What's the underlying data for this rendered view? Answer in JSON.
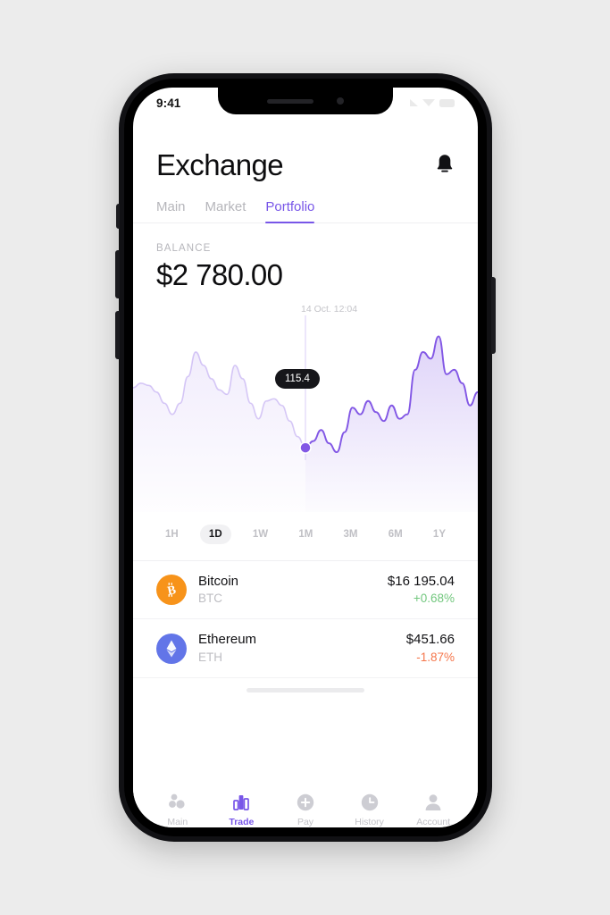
{
  "status_bar": {
    "time": "9:41",
    "icons": [
      "signal-icon",
      "wifi-icon",
      "battery-icon"
    ]
  },
  "header": {
    "title": "Exchange",
    "notification_icon": "bell-icon"
  },
  "tabs": [
    {
      "label": "Main",
      "active": false
    },
    {
      "label": "Market",
      "active": false
    },
    {
      "label": "Portfolio",
      "active": true
    }
  ],
  "balance": {
    "label": "BALANCE",
    "amount": "$2 780.00"
  },
  "chart_data": {
    "type": "area",
    "title": "",
    "xlabel": "",
    "ylabel": "",
    "tooltip_value": "115.4",
    "tooltip_date": "14 Oct. 12:04",
    "marker_index": 22,
    "line_color": "#8257e5",
    "fill_color": "#8257e5",
    "faded_before_marker": true,
    "grid": false,
    "legend": null,
    "ylim": [
      85,
      150
    ],
    "x": [
      0,
      1,
      2,
      3,
      4,
      5,
      6,
      7,
      8,
      9,
      10,
      11,
      12,
      13,
      14,
      15,
      16,
      17,
      18,
      19,
      20,
      21,
      22,
      23,
      24,
      25,
      26,
      27,
      28,
      29,
      30,
      31,
      32,
      33,
      34,
      35,
      36,
      37,
      38,
      39,
      40,
      41,
      42,
      43,
      44
    ],
    "values": [
      124,
      126,
      125,
      122,
      117,
      112,
      117,
      129,
      140,
      134,
      128,
      123,
      121,
      134,
      128,
      117,
      110,
      118,
      119,
      116,
      109,
      102,
      97,
      100,
      105,
      99,
      95,
      104,
      115,
      112,
      118,
      113,
      109,
      116,
      110,
      112,
      132,
      140,
      137,
      147,
      130,
      132,
      126,
      116,
      122
    ]
  },
  "ranges": [
    {
      "label": "1H",
      "active": false
    },
    {
      "label": "1D",
      "active": true
    },
    {
      "label": "1W",
      "active": false
    },
    {
      "label": "1M",
      "active": false
    },
    {
      "label": "3M",
      "active": false
    },
    {
      "label": "6M",
      "active": false
    },
    {
      "label": "1Y",
      "active": false
    }
  ],
  "assets": [
    {
      "name": "Bitcoin",
      "symbol": "BTC",
      "price": "$16 195.04",
      "change": "+0.68%",
      "change_color": "#72c77e",
      "icon_color": "#f7931a",
      "icon_glyph": "₿",
      "icon_name": "bitcoin-icon"
    },
    {
      "name": "Ethereum",
      "symbol": "ETH",
      "price": "$451.66",
      "change": "-1.87%",
      "change_color": "#f5764b",
      "icon_color": "#6275e8",
      "icon_glyph": "⧫",
      "icon_name": "ethereum-icon"
    }
  ],
  "bottom_nav": [
    {
      "label": "Main",
      "icon": "dots-grid-icon",
      "active": false
    },
    {
      "label": "Trade",
      "icon": "bar-chart-icon",
      "active": true
    },
    {
      "label": "Pay",
      "icon": "plus-circle-icon",
      "active": false
    },
    {
      "label": "History",
      "icon": "clock-icon",
      "active": false
    },
    {
      "label": "Account",
      "icon": "person-icon",
      "active": false
    }
  ],
  "theme": {
    "accent": "#7856e8",
    "chart_purple": "#8257e5",
    "positive": "#72c77e",
    "negative": "#f5764b",
    "text_primary": "#0d0d0f",
    "text_muted": "#b6b6bb"
  }
}
